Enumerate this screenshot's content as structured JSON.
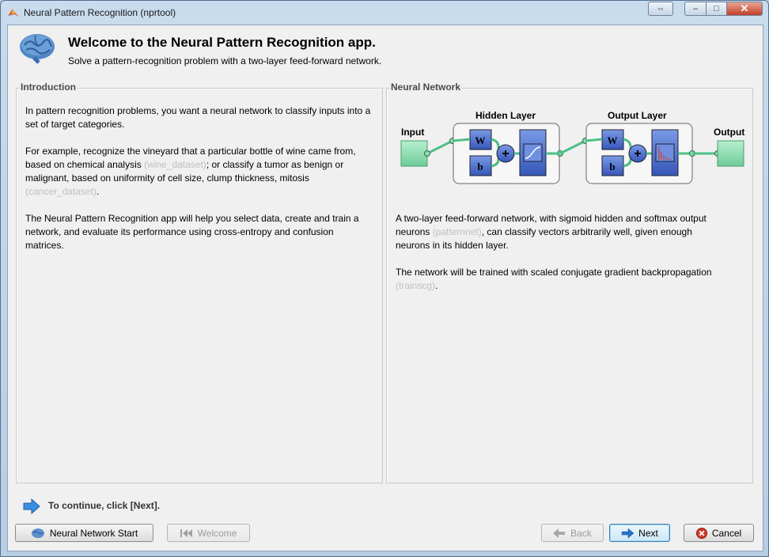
{
  "window": {
    "title": "Neural Pattern Recognition (nprtool)",
    "controls": {
      "restore_alt": "⇔",
      "minimize": "–",
      "maximize": "□",
      "close": "✕"
    }
  },
  "header": {
    "title": "Welcome to the Neural Pattern Recognition app.",
    "subtitle": "Solve a pattern-recognition problem with a two-layer feed-forward network."
  },
  "intro": {
    "title": "Introduction",
    "p1": "In pattern recognition problems, you want a neural network to classify inputs into a set of target categories.",
    "p2_a": "For example, recognize the vineyard that a particular bottle of wine came from, based on chemical analysis ",
    "p2_hint1": "(wine_dataset)",
    "p2_b": "; or classify a tumor as benign or malignant, based on uniformity of cell size, clump thickness, mitosis ",
    "p2_hint2": "(cancer_dataset)",
    "p2_c": ".",
    "p3": "The Neural Pattern Recognition app will help you select data, create and train a network, and evaluate its performance using cross-entropy and confusion matrices."
  },
  "network": {
    "title": "Neural Network",
    "diagram": {
      "input_label": "Input",
      "hidden_label": "Hidden Layer",
      "output_layer_label": "Output Layer",
      "output_label": "Output",
      "weight": "W",
      "bias": "b",
      "sum": "+"
    },
    "p1_a": "A two-layer feed-forward network, with sigmoid hidden and softmax output neurons ",
    "p1_hint": "(patternnet)",
    "p1_b": ", can classify vectors arbitrarily well, given enough neurons in its hidden layer.",
    "p2_a": "The network will be trained with scaled conjugate gradient backpropagation ",
    "p2_hint": "(trainscg)",
    "p2_b": "."
  },
  "footer": {
    "continue_text": "To continue, click [Next].",
    "buttons": {
      "start": "Neural Network Start",
      "welcome": "Welcome",
      "back": "Back",
      "next": "Next",
      "cancel": "Cancel"
    }
  },
  "colors": {
    "block_blue": "#3d63c8",
    "block_green": "#8fdcb0",
    "arrow_green": "#4fbf86",
    "cancel_red": "#d23a2a"
  }
}
